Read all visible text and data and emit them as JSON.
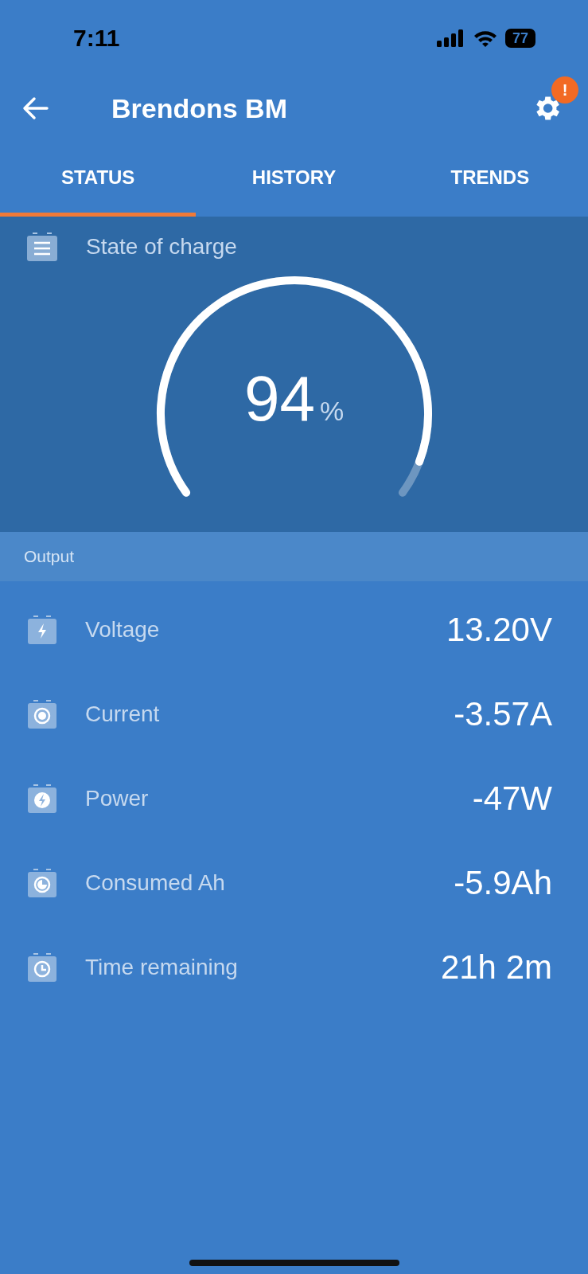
{
  "status_bar": {
    "time": "7:11",
    "battery": "77"
  },
  "header": {
    "title": "Brendons BM",
    "settings_badge": "!"
  },
  "tabs": [
    {
      "label": "STATUS",
      "selected": true
    },
    {
      "label": "HISTORY",
      "selected": false
    },
    {
      "label": "TRENDS",
      "selected": false
    }
  ],
  "state_of_charge": {
    "label": "State of charge",
    "value": "94",
    "unit": "%"
  },
  "output": {
    "heading": "Output",
    "rows": [
      {
        "kind": "voltage",
        "label": "Voltage",
        "value": "13.20V"
      },
      {
        "kind": "current",
        "label": "Current",
        "value": "-3.57A"
      },
      {
        "kind": "power",
        "label": "Power",
        "value": "-47W"
      },
      {
        "kind": "consumed",
        "label": "Consumed Ah",
        "value": "-5.9Ah"
      },
      {
        "kind": "time",
        "label": "Time remaining",
        "value": "21h 2m"
      }
    ]
  }
}
